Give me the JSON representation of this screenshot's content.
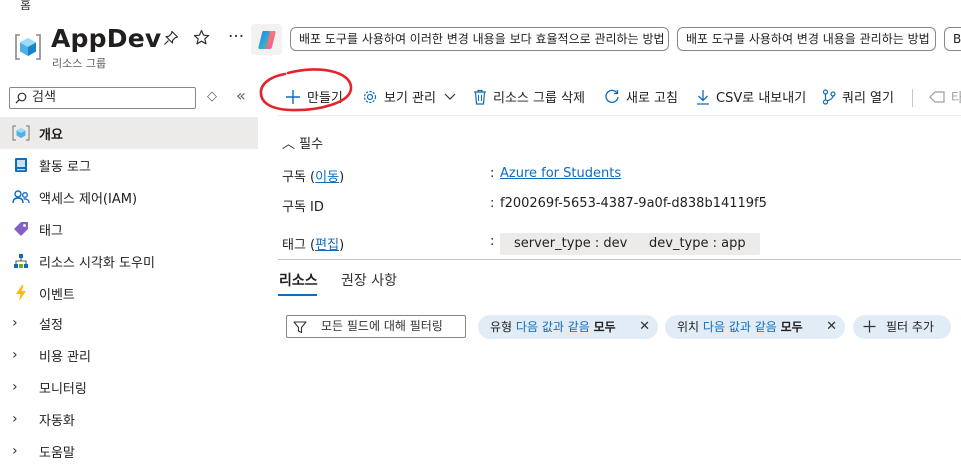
{
  "breadcrumb": "홈",
  "header": {
    "title": "AppDev",
    "subtitle": "리소스 그룹",
    "pin_icon": "pin-icon",
    "star_icon": "star-icon",
    "more_label": "···",
    "copilot_icon": "copilot-icon",
    "prompts": [
      "배포 도구를 사용하여 이러한 변경 내용을 보다 효율적으로 관리하는 방법",
      "배포 도구를 사용하여 변경 내용을 관리하는 방법",
      "Bi"
    ]
  },
  "sidebar": {
    "search_label": "검색",
    "sort_label": "◇",
    "collapse_label": "«",
    "items": [
      {
        "label": "개요",
        "icon": "resource-group-icon",
        "active": true
      },
      {
        "label": "활동 로그",
        "icon": "activity-log-icon"
      },
      {
        "label": "액세스 제어(IAM)",
        "icon": "people-icon"
      },
      {
        "label": "태그",
        "icon": "tag-icon"
      },
      {
        "label": "리소스 시각화 도우미",
        "icon": "visualizer-icon"
      },
      {
        "label": "이벤트",
        "icon": "lightning-icon"
      },
      {
        "label": "설정",
        "expandable": true
      },
      {
        "label": "비용 관리",
        "expandable": true
      },
      {
        "label": "모니터링",
        "expandable": true
      },
      {
        "label": "자동화",
        "expandable": true
      },
      {
        "label": "도움말",
        "expandable": true
      }
    ]
  },
  "toolbar": {
    "create": "만들기",
    "manage_view": "보기 관리",
    "delete_group": "리소스 그룹 삭제",
    "refresh": "새로 고침",
    "export_csv": "CSV로 내보내기",
    "open_query": "쿼리 열기",
    "tags_partial": "타"
  },
  "essentials": {
    "header": "필수",
    "subscription_label": "구독",
    "subscription_move_link": "이동",
    "subscription_value": "Azure for Students",
    "subscription_id_label": "구독 ID",
    "subscription_id_value": "f200269f-5653-4387-9a0f-d838b14119f5",
    "tags_label": "태그",
    "tags_edit_link": "편집",
    "tags": [
      "server_type : dev",
      "dev_type : app"
    ]
  },
  "tabs": [
    "리소스",
    "권장 사항"
  ],
  "filters": {
    "placeholder": "모든 필드에 대해 필터링",
    "chips": [
      {
        "field": "유형",
        "operator": "다음 값과 같음",
        "value": "모두"
      },
      {
        "field": "위치",
        "operator": "다음 값과 같음",
        "value": "모두"
      }
    ],
    "add_filter": "필터 추가"
  },
  "colors": {
    "accent": "#0f6cbd",
    "annotation": "#e3242b",
    "chip_bg": "#e1ecf7"
  }
}
